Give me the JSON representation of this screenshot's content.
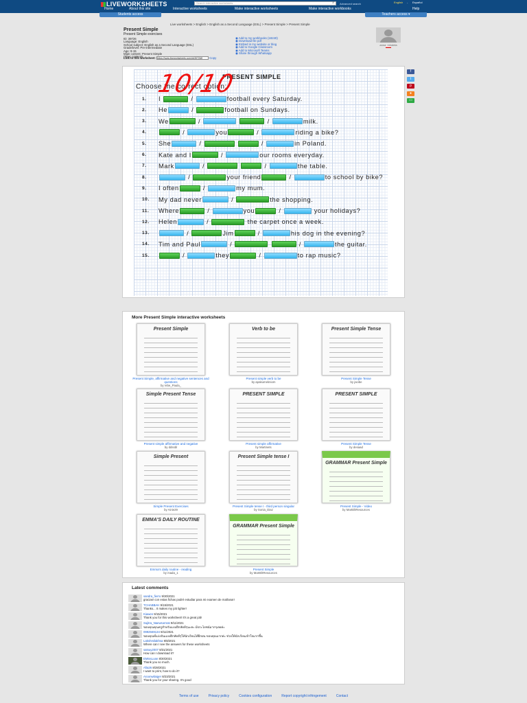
{
  "header": {
    "logo": "LIVEWORKSHEETS",
    "search_placeholder": "Search interactive worksheets",
    "advanced_search": "Advanced search",
    "lang_en": "English",
    "lang_sep": "-",
    "lang_es": "Español",
    "nav": [
      "Home",
      "About this site",
      "Interactive worksheets",
      "Make interactive worksheets",
      "Make interactive workbooks",
      "Help"
    ],
    "students_tab": "Students access",
    "teachers_tab": "Teachers access ▾"
  },
  "breadcrumbs": "Live worksheets > English > English as a Second Language (ESL) > Present Simple > Present Simple",
  "worksheet_info": {
    "title": "Present Simple",
    "subtitle": "Present Simple exercises",
    "lines": [
      "ID: 39726",
      "Language: English",
      "School subject: English as a Second Language (ESL)",
      "Grade/level: Pre-intermediate",
      "Age: 9-15",
      "Main content: Present Simple",
      "Other contents:"
    ],
    "actions": [
      "Add to my workbooks (18240)",
      "Download file pdf",
      "Embed in my website or blog",
      "Add to Google Classroom",
      "Add to Microsoft Teams",
      "Share through Whatsapp"
    ],
    "author": "anna_mlodela",
    "link_label": "Link to this worksheet:",
    "link_value": "https://www.liveworksheets.com/xb39726ff",
    "copy": "Copy"
  },
  "sheet": {
    "title": "PRESENT SIMPLE",
    "instruction": "Choose the correct option:",
    "score": "10/10",
    "rows": [
      {
        "n": "1.",
        "seg": [
          "I ",
          "G",
          " / ",
          "B",
          "football every Saturday."
        ]
      },
      {
        "n": "2.",
        "seg": [
          "He",
          "B",
          " / ",
          "G",
          "football on Sundays."
        ]
      },
      {
        "n": "3.",
        "seg": [
          "We",
          "G",
          " / ",
          "B",
          " ",
          "G",
          " / ",
          "B",
          "milk."
        ]
      },
      {
        "n": "4.",
        "seg": [
          "G",
          " / ",
          "B",
          "you",
          "G",
          " / ",
          "B",
          "riding a bike?"
        ]
      },
      {
        "n": "5.",
        "seg": [
          "She",
          "B",
          " / ",
          "G",
          " ",
          "G",
          " / ",
          "B",
          "in Poland."
        ]
      },
      {
        "n": "6.",
        "seg": [
          "Kate and I",
          "G",
          " / ",
          "B",
          "our rooms everyday."
        ]
      },
      {
        "n": "7.",
        "seg": [
          "Mark",
          "B",
          " / ",
          "G",
          " ",
          "G",
          " / ",
          "B",
          "the table."
        ]
      },
      {
        "n": "8.",
        "seg": [
          "B",
          " / ",
          "G",
          "your friend",
          "G",
          " / ",
          "B",
          "to school by bike?"
        ]
      },
      {
        "n": "9.",
        "seg": [
          "I often",
          "G",
          " / ",
          "B",
          "my mum."
        ]
      },
      {
        "n": "10.",
        "seg": [
          "My dad never",
          "B",
          " / ",
          "G",
          "the shopping."
        ]
      },
      {
        "n": "11.",
        "seg": [
          "Where",
          "G",
          " / ",
          "B",
          "you",
          "G",
          " / ",
          "B",
          " your holidays?"
        ]
      },
      {
        "n": "12.",
        "seg": [
          "Helen",
          "B",
          " / ",
          "G",
          " the carpet once a week."
        ]
      },
      {
        "n": "13.",
        "seg": [
          "B",
          " / ",
          "G",
          "Jim",
          "G",
          " / ",
          "B",
          "his dog in the evening?"
        ]
      },
      {
        "n": "14.",
        "seg": [
          "Tim and Paul",
          "B",
          " / ",
          "G",
          " ",
          "G",
          " / ",
          "B",
          "the guitar."
        ]
      },
      {
        "n": "15.",
        "seg": [
          "G",
          " / ",
          "B",
          "they",
          "G",
          " / ",
          "B",
          "to rap music?"
        ]
      }
    ]
  },
  "social": [
    {
      "icon": "f",
      "color": "#3b5998"
    },
    {
      "icon": "t",
      "color": "#55acee"
    },
    {
      "icon": "p",
      "color": "#bd081c"
    },
    {
      "icon": "●",
      "color": "#f4811f"
    },
    {
      "icon": "▭",
      "color": "#2eaa44"
    }
  ],
  "more": {
    "heading": "More Present Simple interactive worksheets",
    "items": [
      {
        "title": "Present Simple, affirmative and negative sentences and questions",
        "by": "by rebe_Paula_",
        "thumb": "Present Simple"
      },
      {
        "title": "Present simple verb to be",
        "by": "by apakumekniom",
        "thumb": "Verb to be"
      },
      {
        "title": "Present Simple Tense",
        "by": "by jacibe",
        "thumb": "Present Simple Tense"
      },
      {
        "title": "Present simple affirmative and negative",
        "by": "by ddssbl",
        "thumb": "Simple Present Tense"
      },
      {
        "title": "Present simple affirmative",
        "by": "by Martinets",
        "thumb": "PRESENT SIMPLE"
      },
      {
        "title": "Present Simple Tense",
        "by": "by desaad",
        "thumb": "PRESENT SIMPLE"
      },
      {
        "title": "Simple Present Exercises",
        "by": "by Ainie29",
        "thumb": "Simple Present"
      },
      {
        "title": "Present Simple tense I - third person singular",
        "by": "by Sonia_Diaz",
        "thumb": "Present Simple tense I"
      },
      {
        "title": "Present Simple - Video",
        "by": "by MartEltResources",
        "thumb": "GRAMMAR Present Simple"
      },
      {
        "title": "Emma's daily routine - reading",
        "by": "by mada_1",
        "thumb": "EMMA'S DAILY ROUTINE"
      },
      {
        "title": "Present Simple",
        "by": "by MartEltResources",
        "thumb": "GRAMMAR Present Simple"
      }
    ]
  },
  "comments": {
    "heading": "Latest comments",
    "items": [
      {
        "user": "sandra_fierro",
        "date": "9/30/2021",
        "text": "gracias! con estas fichas podré estudiar para mi examen de mañana!!"
      },
      {
        "user": "TCHABBAH",
        "date": "9/15/2021",
        "text": "Thanks... It makes my job lighter!"
      },
      {
        "user": "Kiawen",
        "date": "9/15/2021",
        "text": "Thank you for this worksheet! It's a great job!"
      },
      {
        "user": "Sujitra_Naewsomrat",
        "date": "9/11/2021",
        "text": "ขอบคุณคุณครูสำหรับแบบฝึกหัดดีๆนะคะ มีประโยชน์มากๆเลยค่ะ"
      },
      {
        "user": "0992569134",
        "date": "9/11/2021",
        "text": "ขอบคุณที่แบ่งปันแบบฝึกหัดดีๆให้นักเรียนได้ฝึกฝน ขอบคุณมากค่ะ ช่วยให้นักเรียนเข้าใจมากขึ้น"
      },
      {
        "user": "Lakshmilakhsa",
        "date": "9/8/2021",
        "text": "Where can I see the answers for these worksheets"
      },
      {
        "user": "satsuy2007",
        "date": "8/31/2021",
        "text": "How can I download it?"
      },
      {
        "user": "EMissLoan",
        "date": "8/30/2021",
        "text": "Thank you so much."
      },
      {
        "user": "Afia26",
        "date": "8/28/2021",
        "text": "I want to print, how to do it?"
      },
      {
        "user": "Aroonwilaiger",
        "date": "8/23/2021",
        "text": "Thank you for your sharing. It's good"
      }
    ]
  },
  "footer": [
    "Terms of use",
    "Privacy policy",
    "Cookies configuration",
    "Report copyright infringement",
    "Contact"
  ]
}
